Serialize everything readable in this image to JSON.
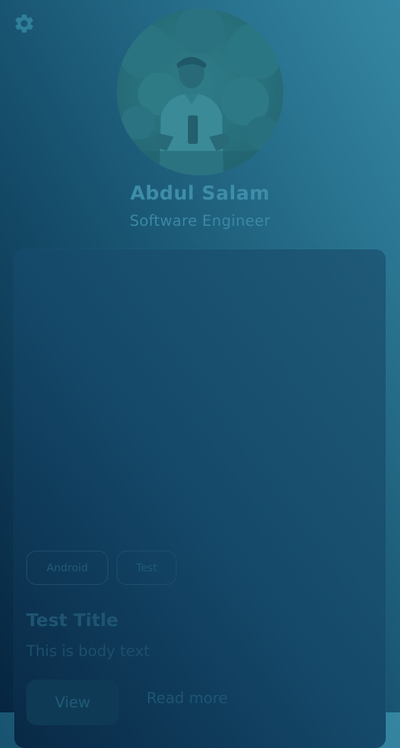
{
  "profile": {
    "name": "Abdul Salam",
    "role": "Software Engineer"
  },
  "card": {
    "tags": [
      "Android",
      "Test"
    ],
    "title": "Test Title",
    "body": "This is body text",
    "primary_action": "View",
    "secondary_action": "Read more"
  },
  "icons": {
    "settings": "gear-icon",
    "avatar": "profile-photo"
  },
  "colors": {
    "background_dark": "#062540",
    "background_light": "#3586a2",
    "text_accent": "#3e8da9",
    "card_text": "#1e5571"
  }
}
